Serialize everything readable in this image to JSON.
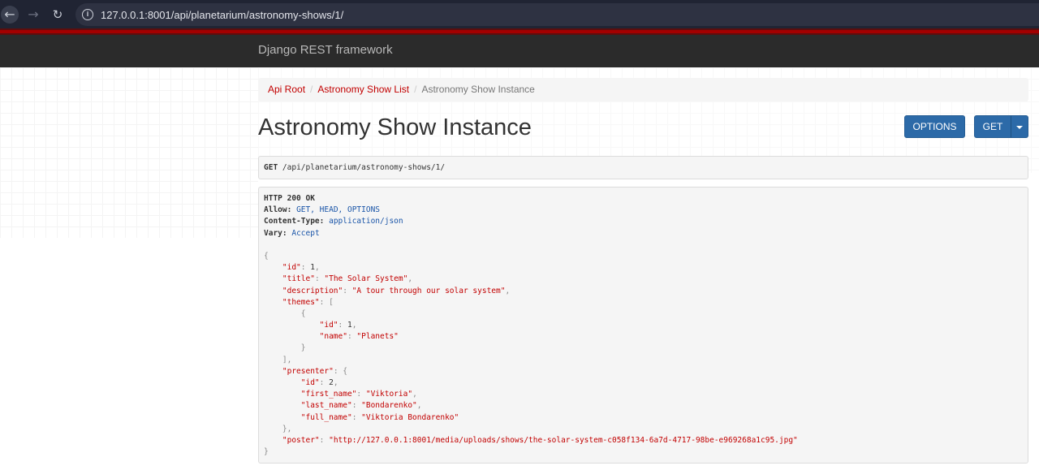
{
  "browser": {
    "url": "127.0.0.1:8001/api/planetarium/astronomy-shows/1/"
  },
  "navbar": {
    "brand": "Django REST framework"
  },
  "breadcrumb": [
    {
      "label": "Api Root"
    },
    {
      "label": "Astronomy Show List"
    },
    {
      "label": "Astronomy Show Instance"
    }
  ],
  "page": {
    "title": "Astronomy Show Instance",
    "options_label": "OPTIONS",
    "get_label": "GET"
  },
  "request": {
    "method": "GET",
    "path": "/api/planetarium/astronomy-shows/1/"
  },
  "response": {
    "status": "HTTP 200 OK",
    "headers": [
      {
        "name": "Allow:",
        "value": "GET, HEAD, OPTIONS"
      },
      {
        "name": "Content-Type:",
        "value": "application/json"
      },
      {
        "name": "Vary:",
        "value": "Accept"
      }
    ],
    "body": {
      "id": "1",
      "title": "\"The Solar System\"",
      "description": "\"A tour through our solar system\"",
      "theme_id": "1",
      "theme_name": "\"Planets\"",
      "presenter_id": "2",
      "presenter_first_name": "\"Viktoria\"",
      "presenter_last_name": "\"Bondarenko\"",
      "presenter_full_name": "\"Viktoria Bondarenko\"",
      "poster": "\"http://127.0.0.1:8001/media/uploads/shows/the-solar-system-c058f134-6a7d-4717-98be-e969268a1c95.jpg\""
    }
  },
  "colors": {
    "accent": "#c20000",
    "button": "#2c6aa8",
    "navbar": "#2b2b2b"
  }
}
